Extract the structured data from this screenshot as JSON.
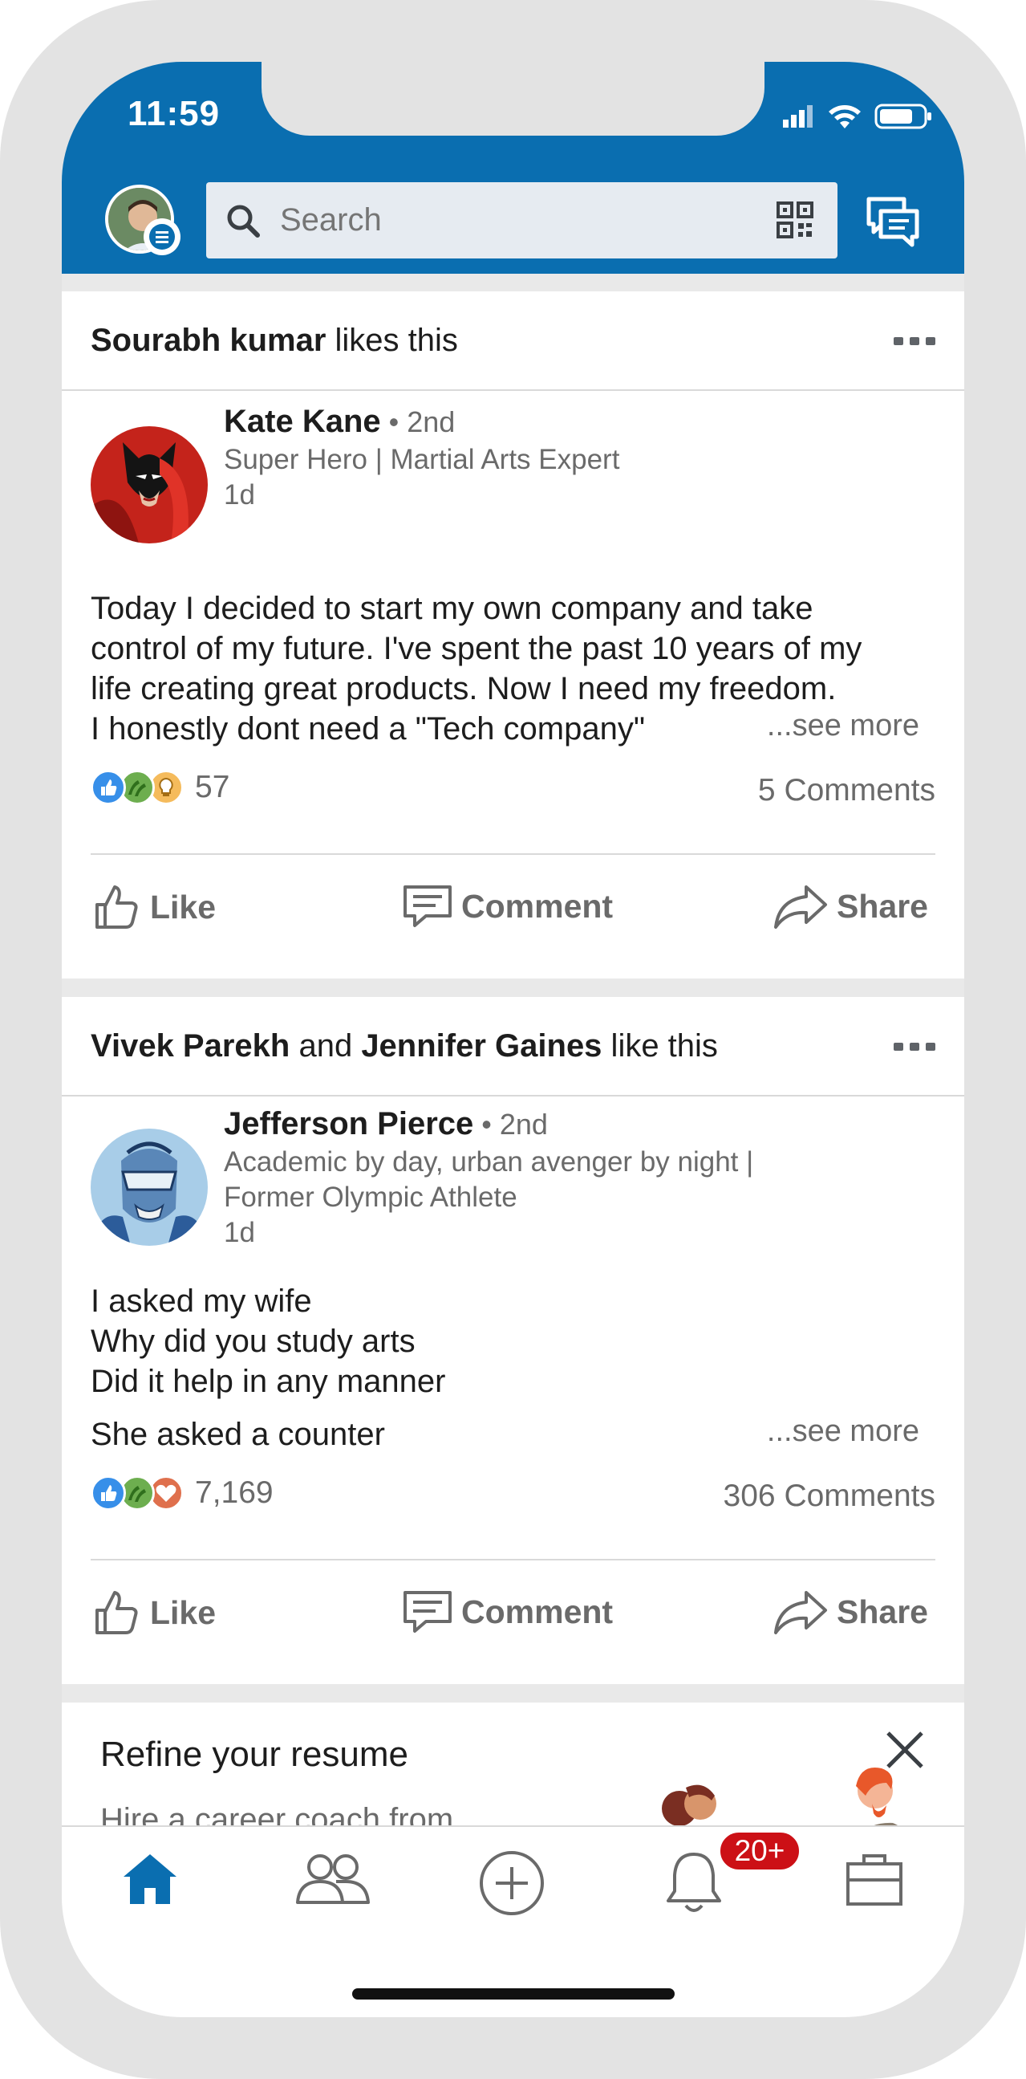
{
  "status_bar": {
    "time": "11:59"
  },
  "header": {
    "search": {
      "placeholder": "Search"
    }
  },
  "posts": [
    {
      "social_actor": "Sourabh kumar",
      "social_text": " likes this",
      "author": {
        "name": "Kate Kane",
        "degree": " • 2nd",
        "headline": "Super Hero | Martial Arts Expert",
        "time": "1d"
      },
      "body_lines": [
        "Today I decided to start my own company and take",
        "control of my future. I've spent the past 10 years of my",
        "life creating great products. Now I need my freedom."
      ],
      "body_last": "I honestly dont need a \"Tech company\"",
      "see_more": "...see more",
      "reaction_count": "57",
      "comments": "5 Comments",
      "actions": {
        "like": "Like",
        "comment": "Comment",
        "share": "Share"
      }
    },
    {
      "social_actor": "Vivek Parekh",
      "social_join": " and ",
      "social_actor2": "Jennifer Gaines",
      "social_text": " like this",
      "author": {
        "name": "Jefferson Pierce",
        "degree": " • 2nd",
        "headline_line1": "Academic by day, urban avenger by night |",
        "headline_line2": "Former Olympic Athlete",
        "time": "1d"
      },
      "body_lines": [
        "I asked my wife",
        "Why did you study arts",
        "Did it help in any manner"
      ],
      "body_last": "She asked a counter",
      "see_more": "...see more",
      "reaction_count": "7,169",
      "comments": "306 Comments",
      "actions": {
        "like": "Like",
        "comment": "Comment",
        "share": "Share"
      }
    }
  ],
  "promo": {
    "title": "Refine your resume",
    "subtitle": "Hire a career coach from"
  },
  "bottom_nav": {
    "notifications_badge": "20+",
    "items": [
      "home-icon",
      "my-network-icon",
      "post-icon",
      "notifications-icon",
      "jobs-icon"
    ]
  },
  "colors": {
    "brand_blue": "#0a6eb0",
    "badge_red": "#cc1016",
    "muted_text": "#6a6a6a"
  }
}
